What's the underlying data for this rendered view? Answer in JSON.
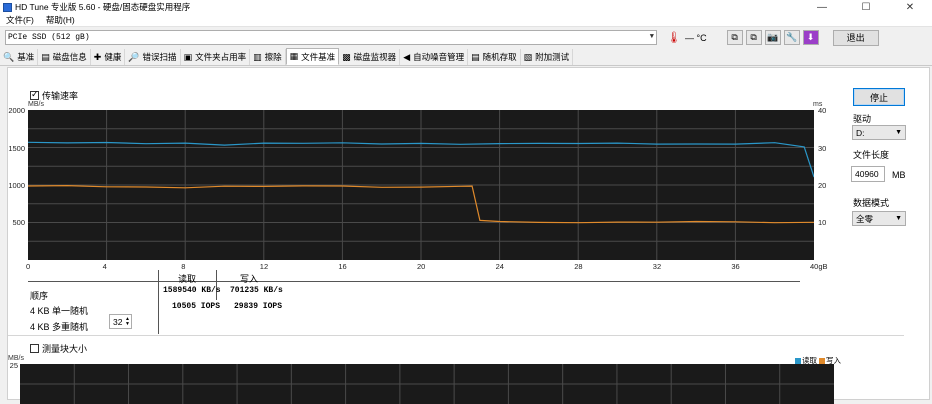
{
  "window": {
    "title": "HD Tune 专业版 5.60 - 硬盘/固态硬盘实用程序",
    "controls": [
      "—",
      "☐",
      "✕"
    ]
  },
  "menu": [
    "文件(F)",
    "帮助(H)"
  ],
  "drivebar": {
    "drive": "PCIe SSD (512 gB)",
    "temperature": "— °C",
    "exit_label": "退出"
  },
  "tabs": [
    {
      "label": "基准",
      "icon": "benchmark-icon"
    },
    {
      "label": "磁盘信息",
      "icon": "disk-info-icon"
    },
    {
      "label": "健康",
      "icon": "health-icon"
    },
    {
      "label": "错误扫描",
      "icon": "error-scan-icon"
    },
    {
      "label": "文件夹占用率",
      "icon": "folder-usage-icon"
    },
    {
      "label": "擦除",
      "icon": "erase-icon"
    },
    {
      "label": "文件基准",
      "icon": "file-benchmark-icon",
      "active": true
    },
    {
      "label": "磁盘监视器",
      "icon": "disk-monitor-icon"
    },
    {
      "label": "自动噪音管理",
      "icon": "aam-icon"
    },
    {
      "label": "随机存取",
      "icon": "random-access-icon"
    },
    {
      "label": "附加测试",
      "icon": "extra-tests-icon"
    }
  ],
  "transfer": {
    "checkbox_label": "传输速率",
    "unit_left": "MB/s",
    "unit_right": "ms",
    "y_left_ticks": [
      "2000",
      "1500",
      "1000",
      "500"
    ],
    "y_right_ticks": [
      "40",
      "30",
      "20",
      "10"
    ],
    "x_ticks": [
      "0",
      "4",
      "8",
      "12",
      "16",
      "20",
      "24",
      "28",
      "32",
      "36",
      "40gB"
    ]
  },
  "chart_data": {
    "type": "line",
    "x_unit": "gB",
    "xlim": [
      0,
      40
    ],
    "y_left_unit": "MB/s",
    "y_left_lim": [
      0,
      2000
    ],
    "y_right_unit": "ms",
    "y_right_lim": [
      0,
      40
    ],
    "grid": true,
    "series": [
      {
        "name": "读取",
        "color": "#2a97c9",
        "x": [
          0,
          2,
          4,
          6,
          8,
          10,
          12,
          14,
          16,
          18,
          20,
          22,
          24,
          26,
          28,
          30,
          32,
          34,
          36,
          38,
          39.5,
          40
        ],
        "y": [
          1570,
          1555,
          1560,
          1550,
          1565,
          1540,
          1560,
          1550,
          1555,
          1545,
          1560,
          1550,
          1555,
          1550,
          1545,
          1555,
          1550,
          1555,
          1550,
          1560,
          1500,
          1100
        ]
      },
      {
        "name": "写入",
        "color": "#e08a2b",
        "x": [
          0,
          2,
          4,
          6,
          8,
          10,
          12,
          14,
          16,
          18,
          20,
          22,
          22.6,
          23,
          24,
          26,
          28,
          30,
          32,
          34,
          36,
          38,
          40
        ],
        "y": [
          980,
          985,
          975,
          980,
          970,
          985,
          975,
          980,
          985,
          975,
          980,
          985,
          980,
          520,
          510,
          505,
          505,
          510,
          500,
          505,
          505,
          500,
          510
        ]
      }
    ]
  },
  "results": {
    "col_read": "读取",
    "col_write": "写入",
    "rows": [
      {
        "label": "顺序",
        "read": "1589540 KB/s",
        "write": "701235 KB/s"
      },
      {
        "label": "4 KB 单一随机",
        "read": "10505 IOPS",
        "write": "29839 IOPS"
      },
      {
        "label": "4 KB 多重随机",
        "queue": "32",
        "read": "",
        "write": ""
      }
    ]
  },
  "block_size": {
    "checkbox_label": "测量块大小",
    "unit": "MB/s",
    "y_top_tick": "25",
    "legend_read": "读取",
    "legend_write": "写入"
  },
  "sidebar": {
    "stop_label": "停止",
    "drive_label": "驱动",
    "drive_value": "D:",
    "file_length_label": "文件长度",
    "file_length_value": "40960",
    "file_length_unit": "MB",
    "data_mode_label": "数据模式",
    "data_mode_value": "全零"
  },
  "colors": {
    "chart_bg": "#1a1a1a",
    "read": "#2a97c9",
    "write": "#e08a2b",
    "accent": "#0078d7"
  }
}
